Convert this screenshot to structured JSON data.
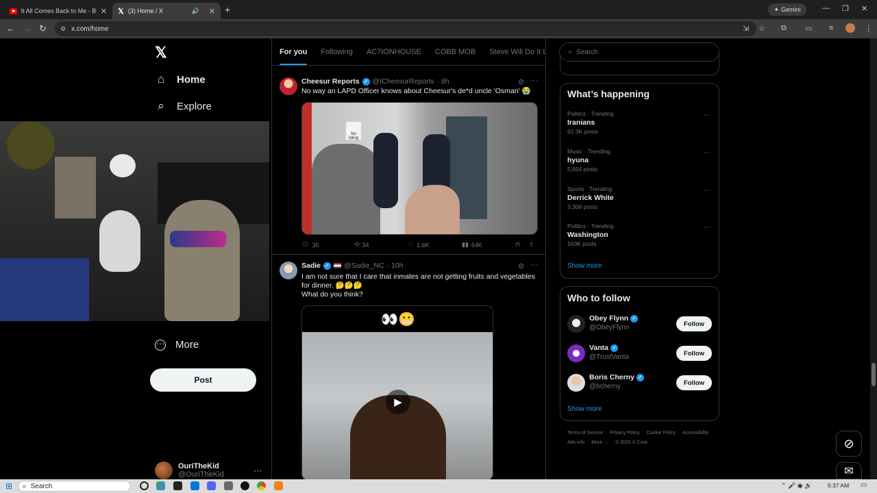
{
  "browser": {
    "tabs": [
      {
        "title": "It All Comes Back to Me - Baby"
      },
      {
        "title": "(3) Home / X"
      }
    ],
    "gemini_label": "Gemini",
    "url": "x.com/home"
  },
  "left_nav": {
    "items": [
      {
        "label": "Home",
        "icon": "home-icon"
      },
      {
        "label": "Explore",
        "icon": "search-icon"
      },
      {
        "label": "More",
        "icon": "more-circle-icon"
      }
    ],
    "post_button": "Post",
    "account": {
      "name": "OuriTheKid",
      "handle": "@OuriTheKid"
    }
  },
  "feed": {
    "tabs": [
      "For you",
      "Following",
      "AC7IONHOUSE",
      "COBB MOB",
      "Steve Will Do It Loyal"
    ],
    "tweets": [
      {
        "name": "Cheesur Reports",
        "handle": "@ICheesurReports",
        "time": "· 8h",
        "text": "No way an LAPD Officer knows about Cheesur's de*d uncle 'Osman' 😭",
        "sign_text": "No Idling",
        "stats": {
          "replies": "30",
          "reposts": "34",
          "likes": "1.6K",
          "views": "64K"
        }
      },
      {
        "name": "Sadie",
        "handle": "@Sadie_NC",
        "time": "· 10h",
        "text_lines": [
          "I am not sure that I care that inmates are not getting fruits and vegetables",
          "for dinner. 🤔🤔🤔",
          "What do you think?"
        ],
        "video_caption": "👀😬"
      }
    ]
  },
  "right": {
    "search_placeholder": "Search",
    "whats_happening": {
      "title": "What’s happening",
      "trends": [
        {
          "meta": "Politics · Trending",
          "name": "Iranians",
          "posts": "92.3K posts"
        },
        {
          "meta": "Music · Trending",
          "name": "hyuna",
          "posts": "5,654 posts"
        },
        {
          "meta": "Sports · Trending",
          "name": "Derrick White",
          "posts": "3,306 posts"
        },
        {
          "meta": "Politics · Trending",
          "name": "Washington",
          "posts": "163K posts"
        }
      ],
      "show_more": "Show more"
    },
    "who_to_follow": {
      "title": "Who to follow",
      "accounts": [
        {
          "name": "Obey Flynn",
          "handle": "@ObeyFlynn",
          "button": "Follow"
        },
        {
          "name": "Vanta",
          "handle": "@TrustVanta",
          "button": "Follow"
        },
        {
          "name": "Boris Cherny",
          "handle": "@bcherny",
          "button": "Follow"
        }
      ],
      "show_more": "Show more"
    },
    "footer": {
      "links": [
        "Terms of Service",
        "Privacy Policy",
        "Cookie Policy",
        "Accessibility",
        "Ads info",
        "More ···"
      ],
      "copyright": "© 2025 X Corp."
    }
  },
  "taskbar": {
    "search_label": "Search",
    "time": "5:37 AM"
  },
  "colors": {
    "accent": "#1d9bf0",
    "background": "#000000",
    "border": "#2f3336"
  }
}
